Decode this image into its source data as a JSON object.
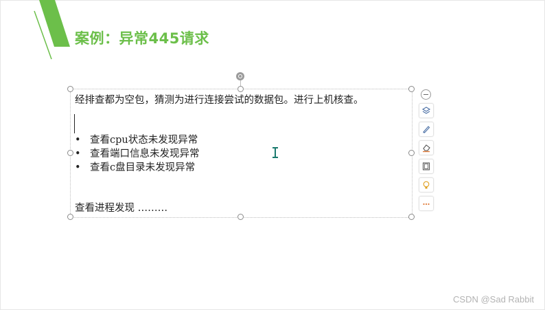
{
  "slide": {
    "title": "案例：异常445请求",
    "accent_color": "#6cbf4a"
  },
  "textbox": {
    "paragraph1": "经排查都为空包，猜测为进行连接尝试的数据包。进行上机核查。",
    "bullets": [
      {
        "symbol": "•",
        "text": "查看cpu状态未发现异常"
      },
      {
        "symbol": "•",
        "text": "查看端口信息未发现异常"
      },
      {
        "symbol": "•",
        "text": "查看c盘目录未发现异常"
      }
    ],
    "paragraph2": "查看进程发现 ………"
  },
  "toolbar": {
    "icons": [
      "collapse-icon",
      "layers-icon",
      "pen-icon",
      "eraser-icon",
      "frame-icon",
      "lightbulb-icon",
      "more-icon"
    ]
  },
  "watermark": "CSDN @Sad Rabbit"
}
